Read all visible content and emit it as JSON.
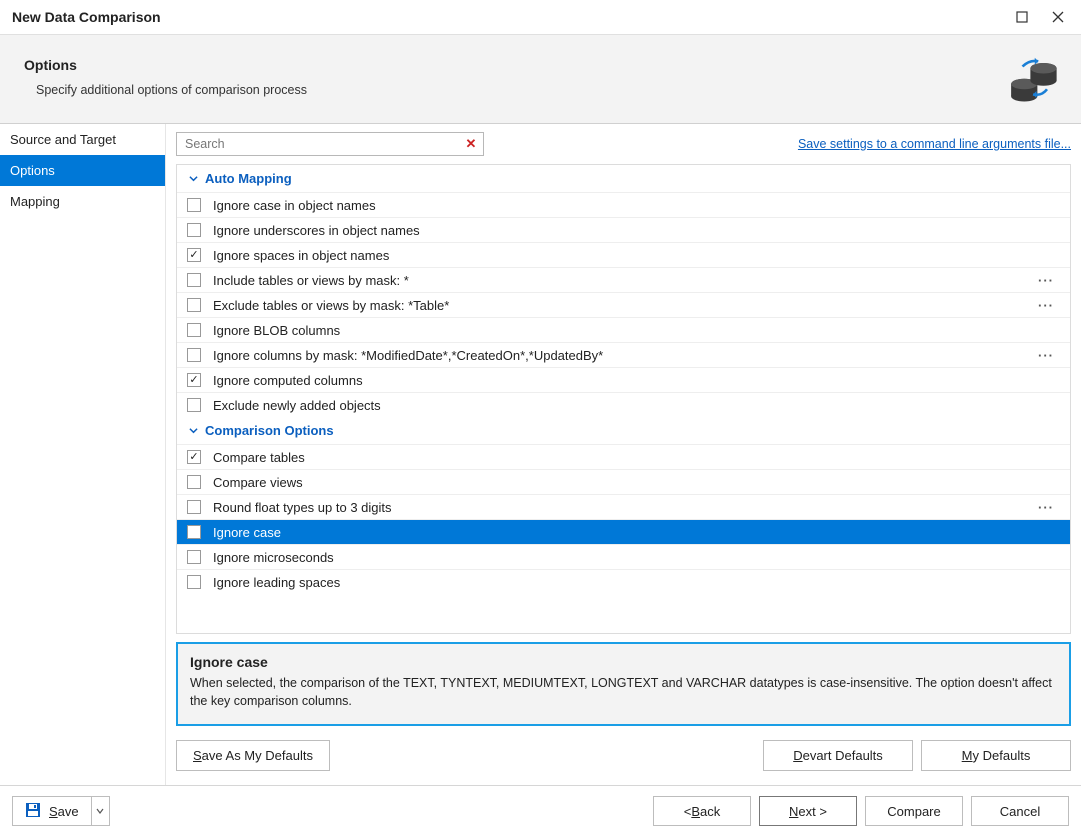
{
  "window": {
    "title": "New Data Comparison"
  },
  "header": {
    "title": "Options",
    "subtitle": "Specify additional options of comparison process"
  },
  "nav": {
    "items": [
      {
        "label": "Source and Target",
        "active": false
      },
      {
        "label": "Options",
        "active": true
      },
      {
        "label": "Mapping",
        "active": false
      }
    ]
  },
  "search": {
    "placeholder": "Search"
  },
  "save_link": "Save settings to a command line arguments file...",
  "sections": [
    {
      "title": "Auto Mapping",
      "items": [
        {
          "label": "Ignore case in object names",
          "checked": false
        },
        {
          "label": "Ignore underscores in object names",
          "checked": false
        },
        {
          "label": "Ignore spaces in object names",
          "checked": true
        },
        {
          "label": "Include tables or views by mask: *",
          "checked": false,
          "more": true
        },
        {
          "label": "Exclude tables or views by mask: *Table*",
          "checked": false,
          "more": true
        },
        {
          "label": "Ignore BLOB columns",
          "checked": false
        },
        {
          "label": "Ignore columns by mask: *ModifiedDate*,*CreatedOn*,*UpdatedBy*",
          "checked": false,
          "more": true
        },
        {
          "label": "Ignore computed columns",
          "checked": true
        },
        {
          "label": "Exclude newly added objects",
          "checked": false
        }
      ]
    },
    {
      "title": "Comparison Options",
      "items": [
        {
          "label": "Compare tables",
          "checked": true
        },
        {
          "label": "Compare views",
          "checked": false
        },
        {
          "label": "Round float types up to 3 digits",
          "checked": false,
          "more": true
        },
        {
          "label": "Ignore case",
          "checked": false,
          "selected": true
        },
        {
          "label": "Ignore microseconds",
          "checked": false
        },
        {
          "label": "Ignore leading spaces",
          "checked": false
        }
      ]
    }
  ],
  "description": {
    "title": "Ignore case",
    "body": "When selected, the comparison of the TEXT, TYNTEXT, MEDIUMTEXT, LONGTEXT and VARCHAR datatypes is case-insensitive. The option doesn't affect the key comparison columns."
  },
  "defaults": {
    "save_as": "Save As My Defaults",
    "devart": "Devart Defaults",
    "my": "My Defaults",
    "save_as_mnemonic": "S",
    "devart_mnemonic": "D",
    "my_mnemonic": "M"
  },
  "footer": {
    "save": "Save",
    "save_mnemonic": "S",
    "back": "< Back",
    "back_mnemonic": "B",
    "next": "Next >",
    "next_mnemonic": "N",
    "compare": "Compare",
    "cancel": "Cancel"
  }
}
